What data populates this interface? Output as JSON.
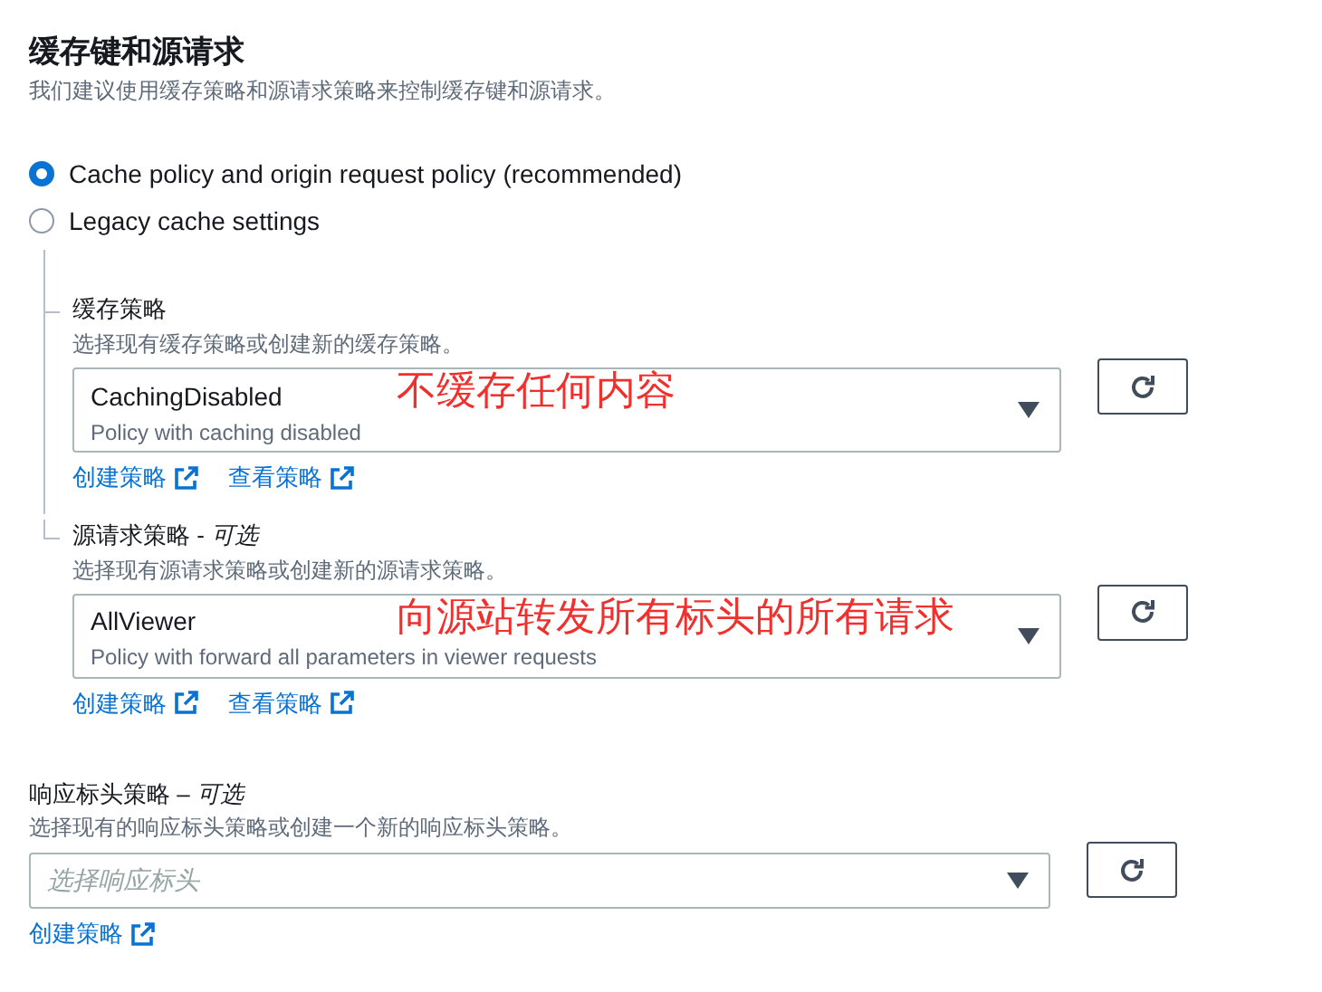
{
  "header": {
    "title": "缓存键和源请求",
    "description": "我们建议使用缓存策略和源请求策略来控制缓存键和源请求。"
  },
  "options": [
    {
      "label": "Cache policy and origin request policy (recommended)",
      "selected": true
    },
    {
      "label": "Legacy cache settings",
      "selected": false
    }
  ],
  "policies": [
    {
      "label": "缓存策略",
      "description": "选择现有缓存策略或创建新的缓存策略。",
      "value": "CachingDisabled",
      "detail": "Policy with caching disabled",
      "annotation": "不缓存任何内容",
      "links": [
        "创建策略",
        "查看策略"
      ]
    },
    {
      "label": "源请求策略 - *可选*",
      "description": "选择现有源请求策略或创建新的源请求策略。",
      "value": "AllViewer",
      "detail": "Policy with forward all parameters in viewer requests",
      "annotation": "向源站转发所有标头的所有请求",
      "links": [
        "创建策略",
        "查看策略"
      ]
    }
  ],
  "response_headers_policy": {
    "label": "响应标头策略 – *可选*",
    "description": "选择现有的响应标头策略或创建一个新的响应标头策略。",
    "placeholder": "选择响应标头",
    "links": [
      "创建策略"
    ]
  }
}
